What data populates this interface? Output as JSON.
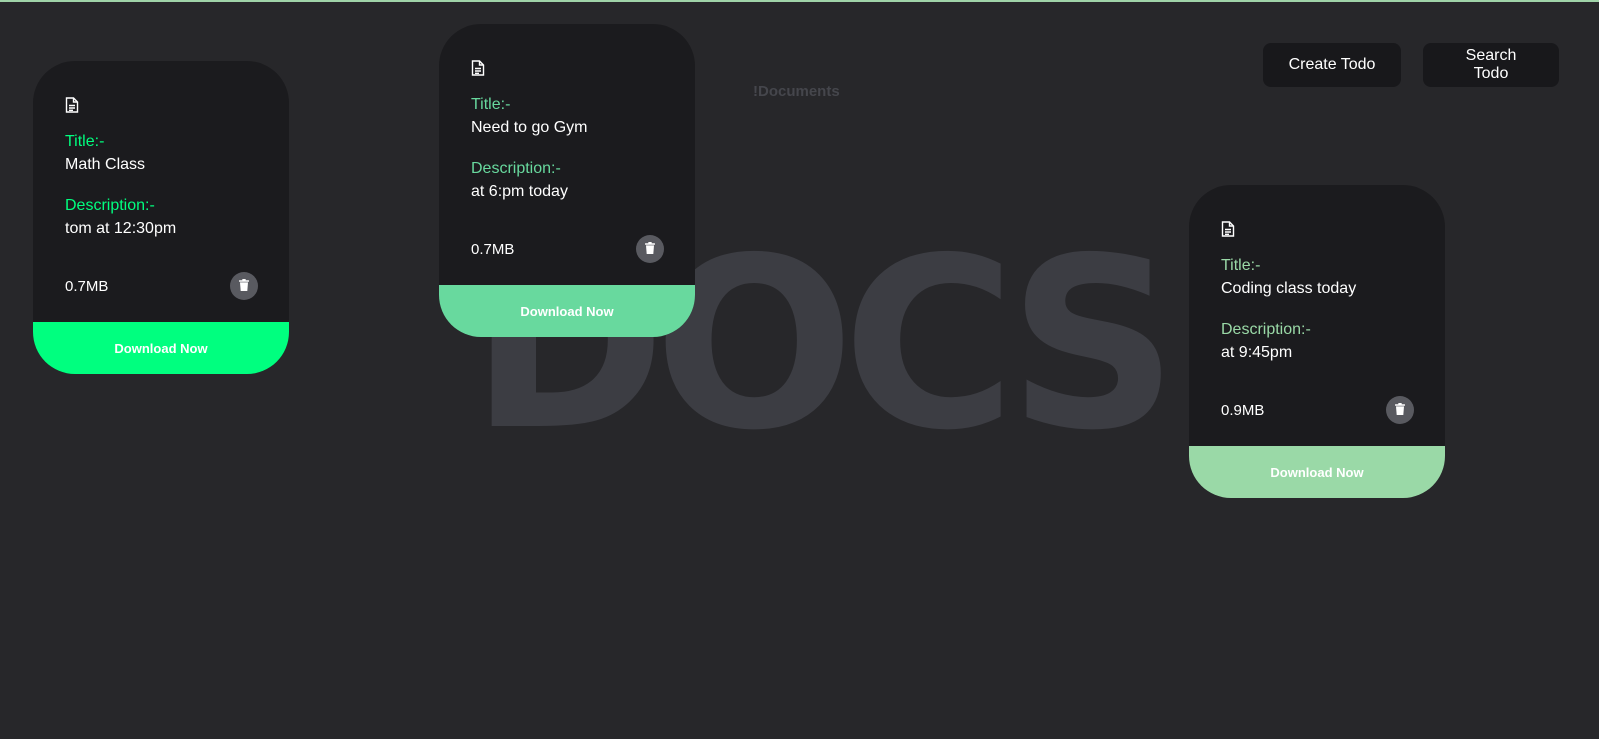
{
  "background_heading": "DOCS.",
  "subtitle": "!Documents",
  "toolbar": {
    "create_label": "Create Todo",
    "search_label": "Search Todo"
  },
  "cards": [
    {
      "icon": "document-icon",
      "title_label": "Title:-",
      "title": "Math Class",
      "description_label": "Description:-",
      "description": "tom at 12:30pm",
      "size": "0.7MB",
      "delete_icon": "trash-icon",
      "download_label": "Download Now",
      "accent_color": "#00ff7f",
      "footer_color": "#00ff7f"
    },
    {
      "icon": "document-icon",
      "title_label": "Title:-",
      "title": "Need to go Gym",
      "description_label": "Description:-",
      "description": "at 6:pm today",
      "size": "0.7MB",
      "delete_icon": "trash-icon",
      "download_label": "Download Now",
      "accent_color": "#68d99e",
      "footer_color": "#68d99e"
    },
    {
      "icon": "document-icon",
      "title_label": "Title:-",
      "title": "Coding class today",
      "description_label": "Description:-",
      "description": "at 9:45pm",
      "size": "0.9MB",
      "delete_icon": "trash-icon",
      "download_label": "Download Now",
      "accent_color": "#9ad9a7",
      "footer_color": "#9ad9a7"
    }
  ]
}
